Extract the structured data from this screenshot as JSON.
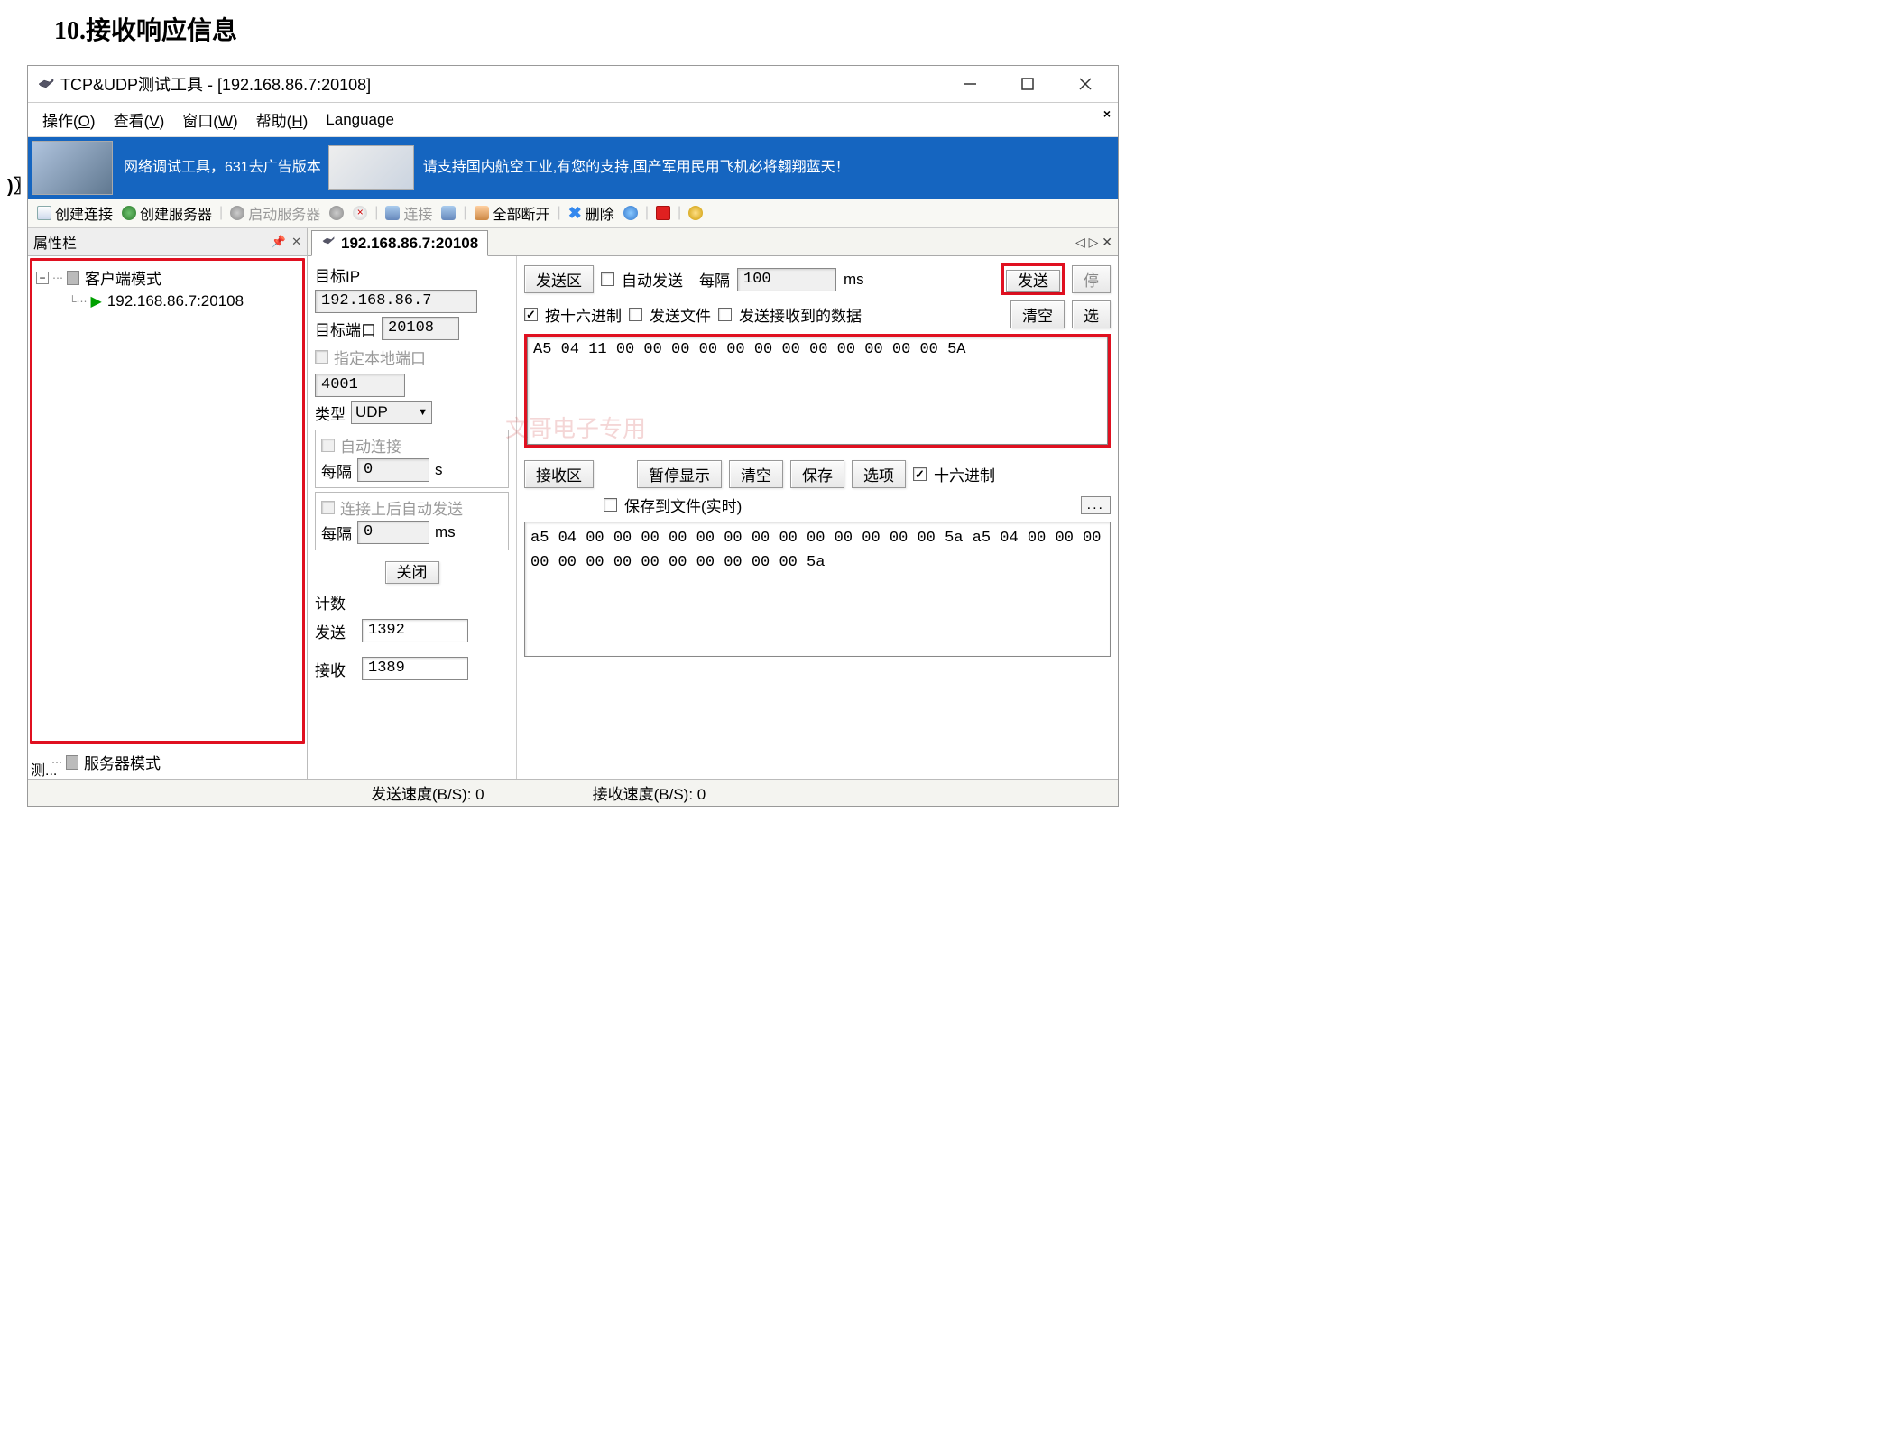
{
  "heading": "10.接收响应信息",
  "window": {
    "title": "TCP&UDP测试工具 - [192.168.86.7:20108]"
  },
  "menubar": {
    "op": "操作(O)",
    "view": "查看(V)",
    "win": "窗口(W)",
    "help": "帮助(H)",
    "lang": "Language"
  },
  "banner": {
    "left": "网络调试工具，631去广告版本",
    "right": "请支持国内航空工业,有您的支持,国产军用民用飞机必将翱翔蓝天！"
  },
  "toolbar": {
    "createConn": "创建连接",
    "createSrv": "创建服务器",
    "startSrv": "启动服务器",
    "connect": "连接",
    "discAll": "全部断开",
    "delete": "删除"
  },
  "sidebar": {
    "title": "属性栏",
    "client": "客户端模式",
    "clientItem": "192.168.86.7:20108",
    "server": "服务器模式"
  },
  "tabs": {
    "active": "192.168.86.7:20108"
  },
  "conn": {
    "targetIpLabel": "目标IP",
    "targetIp": "192.168.86.7",
    "targetPortLabel": "目标端口",
    "targetPort": "20108",
    "localPortLabel": "指定本地端口",
    "localPort": "4001",
    "typeLabel": "类型",
    "type": "UDP",
    "autoConnLabel": "自动连接",
    "intervalLabel": "每隔",
    "autoConnInterval": "0",
    "sUnit": "s",
    "autoSendAfterConnLabel": "连接上后自动发送",
    "autoSendInterval": "0",
    "msUnit": "ms",
    "closeBtn": "关闭"
  },
  "count": {
    "title": "计数",
    "sendLabel": "发送",
    "sendVal": "1392",
    "recvLabel": "接收",
    "recvVal": "1389"
  },
  "sendArea": {
    "title": "发送区",
    "autoSendLabel": "自动发送",
    "intervalLabel": "每隔",
    "intervalVal": "100",
    "msUnit": "ms",
    "sendBtn": "发送",
    "stopBtn": "停",
    "hexLabel": "按十六进制",
    "sendFileLabel": "发送文件",
    "sendRecvLabel": "发送接收到的数据",
    "clearBtn": "清空",
    "optBtn": "选",
    "data": "A5 04 11 00 00 00 00 00 00 00 00 00 00 00 00 5A"
  },
  "recvArea": {
    "title": "接收区",
    "pauseBtn": "暂停显示",
    "clearBtn": "清空",
    "saveBtn": "保存",
    "optBtn": "选项",
    "hexLabel": "十六进制",
    "saveFileLabel": "保存到文件(实时)",
    "browse": "...",
    "data": "a5 04 00 00 00 00 00 00 00 00 00 00 00 00 00 5a a5 04 00 00 00 00 00 00 00 00 00 00 00 00 00 5a"
  },
  "status": {
    "sendSpeed": "发送速度(B/S): 0",
    "recvSpeed": "接收速度(B/S): 0"
  },
  "watermark": "文哥电子专用",
  "leftMarginSym": ")〗",
  "leftTrunc": "测..."
}
